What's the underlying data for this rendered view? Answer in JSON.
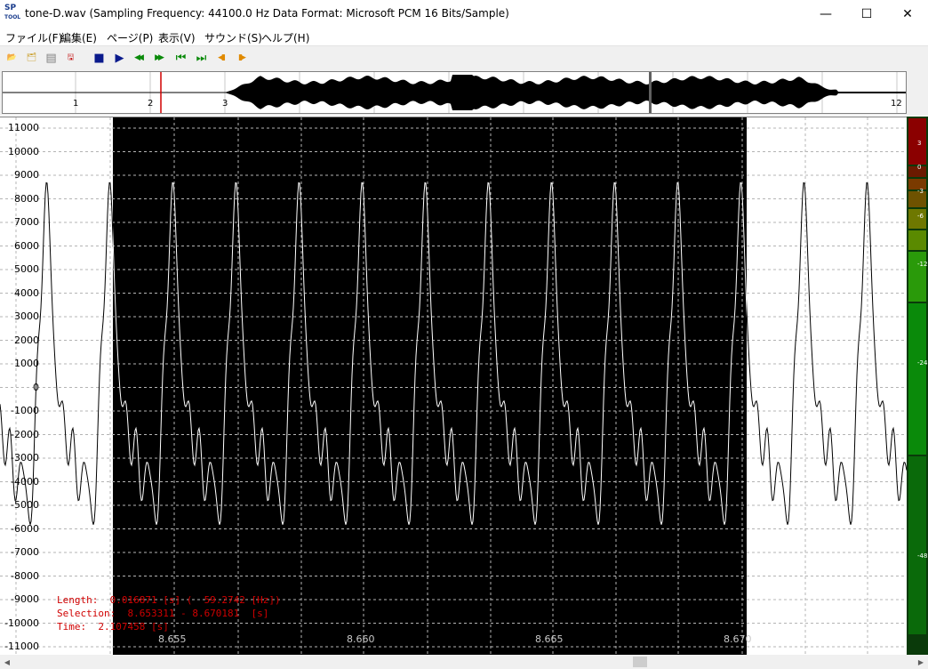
{
  "window": {
    "icon_text": "SP",
    "icon_sub": "TOOL",
    "title": "tone-D.wav  (Sampling Frequency: 44100.0 Hz  Data Format: Microsoft PCM  16 Bits/Sample)",
    "min_glyph": "—",
    "max_glyph": "☐",
    "close_glyph": "✕"
  },
  "menu": [
    {
      "label": "ファイル(F)"
    },
    {
      "label": "編集(E)"
    },
    {
      "label": "ページ(P)"
    },
    {
      "label": "表示(V)"
    },
    {
      "label": "サウンド(S)"
    },
    {
      "label": "ヘルプ(H)"
    }
  ],
  "toolbar": [
    {
      "name": "open-icon",
      "glyph": "📂",
      "color": "#c89a20"
    },
    {
      "name": "open-multiple-icon",
      "glyph": "🗂",
      "color": "#c89a20"
    },
    {
      "name": "save-icon",
      "glyph": "▤",
      "color": "#808080"
    },
    {
      "name": "save-as-icon",
      "glyph": "🖫",
      "color": "#c00000"
    },
    {
      "name": "stop-icon",
      "glyph": "■",
      "color": "#0a1a8c"
    },
    {
      "name": "play-icon",
      "glyph": "▶",
      "color": "#0a1a8c"
    },
    {
      "name": "rewind-icon",
      "glyph": "◀◀",
      "color": "#0a8a0a"
    },
    {
      "name": "fast-forward-icon",
      "glyph": "▶▶",
      "color": "#0a8a0a"
    },
    {
      "name": "skip-start-icon",
      "glyph": "⏮",
      "color": "#0a8a0a"
    },
    {
      "name": "skip-end-icon",
      "glyph": "⏭",
      "color": "#0a8a0a"
    },
    {
      "name": "prev-page-icon",
      "glyph": "◀▮",
      "color": "#e08a00"
    },
    {
      "name": "next-page-icon",
      "glyph": "▮▶",
      "color": "#e08a00"
    }
  ],
  "overview": {
    "labels": [
      "1",
      "2",
      "3",
      "12"
    ]
  },
  "y_axis": {
    "labels": [
      "11000",
      "10000",
      "9000",
      "8000",
      "7000",
      "6000",
      "5000",
      "4000",
      "3000",
      "2000",
      "1000",
      "0",
      "-1000",
      "-2000",
      "-3000",
      "-4000",
      "-5000",
      "-6000",
      "-7000",
      "-8000",
      "-9000",
      "-10000",
      "-11000"
    ]
  },
  "x_axis": {
    "labels": [
      "8.655",
      "8.660",
      "8.665",
      "8.670"
    ]
  },
  "info": {
    "length": "Length:  0.016871 [s] (  59.2742 [Hz])",
    "selection": "Selection:  8.653311 - 8.670181  [s]",
    "time": "Time:  2.107458 [s]"
  },
  "meter": {
    "labels": [
      "3",
      "0",
      "-3",
      "-6",
      "-12",
      "-24",
      "-48"
    ]
  },
  "colors": {
    "selection_bg": "#000000",
    "waveform_on_white": "#000000",
    "waveform_on_black": "#ffffff",
    "info_text": "#d00000",
    "cursor": "#d00000"
  }
}
